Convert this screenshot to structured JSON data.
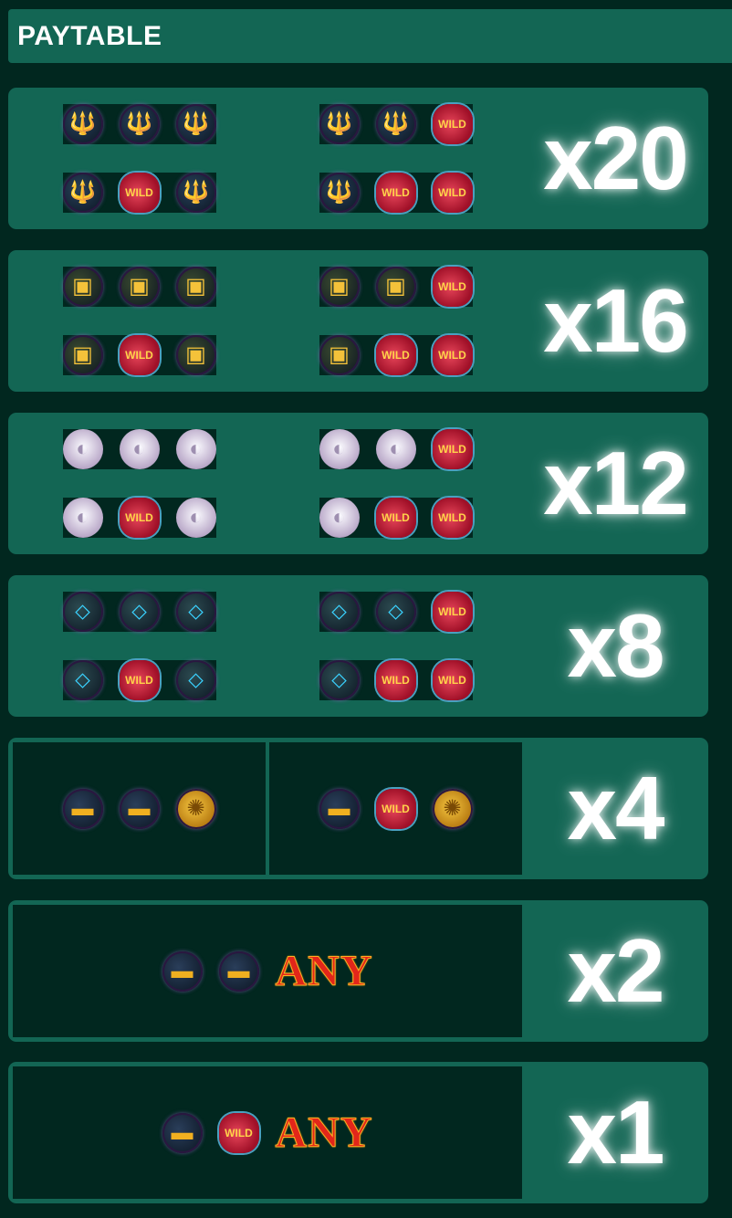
{
  "header": {
    "title": "PAYTABLE"
  },
  "icons": {
    "trident": "🔱",
    "chest": "▣",
    "pearl": "◐",
    "necklace": "⬦",
    "sub": "▬",
    "coin": "✺",
    "wild": "WILD"
  },
  "paytable": [
    {
      "multiplier": "x20",
      "left": [
        [
          "trident",
          "trident",
          "trident"
        ],
        [
          "trident",
          "wild",
          "trident"
        ]
      ],
      "right": [
        [
          "trident",
          "trident",
          "wild"
        ],
        [
          "trident",
          "wild",
          "wild"
        ]
      ]
    },
    {
      "multiplier": "x16",
      "left": [
        [
          "chest",
          "chest",
          "chest"
        ],
        [
          "chest",
          "wild",
          "chest"
        ]
      ],
      "right": [
        [
          "chest",
          "chest",
          "wild"
        ],
        [
          "chest",
          "wild",
          "wild"
        ]
      ]
    },
    {
      "multiplier": "x12",
      "left": [
        [
          "pearl",
          "pearl",
          "pearl"
        ],
        [
          "pearl",
          "wild",
          "pearl"
        ]
      ],
      "right": [
        [
          "pearl",
          "pearl",
          "wild"
        ],
        [
          "pearl",
          "wild",
          "wild"
        ]
      ]
    },
    {
      "multiplier": "x8",
      "left": [
        [
          "necklace",
          "necklace",
          "necklace"
        ],
        [
          "necklace",
          "wild",
          "necklace"
        ]
      ],
      "right": [
        [
          "necklace",
          "necklace",
          "wild"
        ],
        [
          "necklace",
          "wild",
          "wild"
        ]
      ]
    },
    {
      "multiplier": "x4",
      "left": [
        [
          "sub",
          "sub",
          "coin"
        ]
      ],
      "right": [
        [
          "sub",
          "wild",
          "coin"
        ]
      ]
    },
    {
      "multiplier": "x2",
      "combo": [
        "sub",
        "sub"
      ],
      "any_label": "ANY"
    },
    {
      "multiplier": "x1",
      "combo": [
        "sub",
        "wild"
      ],
      "any_label": "ANY"
    }
  ]
}
